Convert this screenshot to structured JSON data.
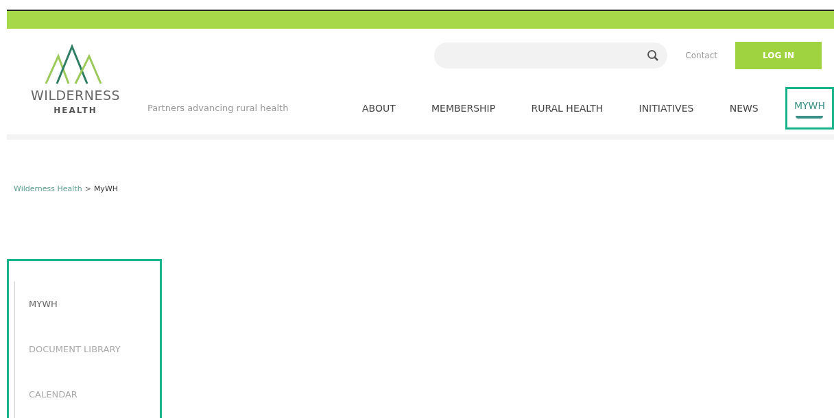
{
  "logo": {
    "name": "WILDERNESS",
    "sub": "HEALTH"
  },
  "tagline": "Partners advancing rural health",
  "contact_link": "Contact",
  "login_button": "LOG IN",
  "nav": [
    {
      "label": "ABOUT",
      "selected": false,
      "highlighted": false
    },
    {
      "label": "MEMBERSHIP",
      "selected": false,
      "highlighted": false
    },
    {
      "label": "RURAL HEALTH",
      "selected": false,
      "highlighted": false
    },
    {
      "label": "INITIATIVES",
      "selected": false,
      "highlighted": false
    },
    {
      "label": "NEWS",
      "selected": false,
      "highlighted": false
    },
    {
      "label": "MYWH",
      "selected": true,
      "highlighted": true
    }
  ],
  "breadcrumb": {
    "link": "Wilderness Health",
    "separator": ">",
    "current": "MyWH"
  },
  "sidebar": {
    "highlighted": true,
    "items": [
      {
        "label": "MYWH",
        "selected": true
      },
      {
        "label": "DOCUMENT LIBRARY",
        "selected": false
      },
      {
        "label": "CALENDAR",
        "selected": false
      }
    ]
  }
}
